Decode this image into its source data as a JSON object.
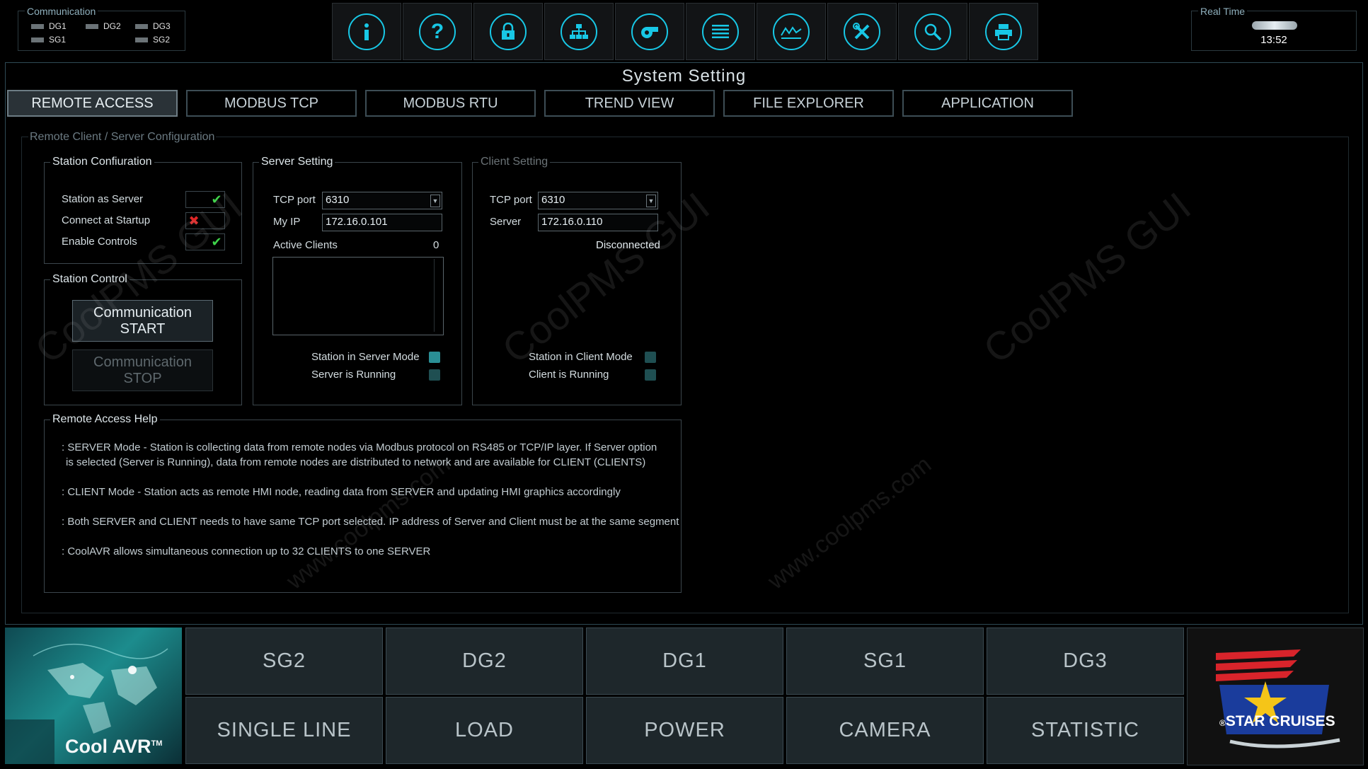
{
  "communication": {
    "title": "Communication",
    "channels": [
      "DG1",
      "DG2",
      "DG3",
      "SG1",
      "SG2"
    ]
  },
  "toolbar": {
    "icons": [
      "info-icon",
      "help-icon",
      "lock-icon",
      "network-icon",
      "whistle-icon",
      "list-icon",
      "trend-icon",
      "tools-icon",
      "search-icon",
      "printer-icon"
    ]
  },
  "real_time": {
    "title": "Real Time",
    "time": "13:52"
  },
  "page_title": "System Setting",
  "tabs": [
    "REMOTE ACCESS",
    "MODBUS TCP",
    "MODBUS RTU",
    "TREND VIEW",
    "FILE EXPLORER",
    "APPLICATION"
  ],
  "section_title": "Remote Client / Server Configuration",
  "station_configuration": {
    "title": "Station Confiuration",
    "items": [
      {
        "label": "Station as Server",
        "state": "checked"
      },
      {
        "label": "Connect at Startup",
        "state": "crossed"
      },
      {
        "label": "Enable Controls",
        "state": "checked"
      }
    ]
  },
  "station_control": {
    "title": "Station Control",
    "start_line1": "Communication",
    "start_line2": "START",
    "stop_line1": "Communication",
    "stop_line2": "STOP"
  },
  "server_setting": {
    "title": "Server Setting",
    "tcp_port_label": "TCP port",
    "tcp_port": "6310",
    "my_ip_label": "My IP",
    "my_ip": "172.16.0.101",
    "active_clients_label": "Active Clients",
    "active_clients": "0",
    "mode_label": "Station in Server Mode",
    "running_label": "Server is Running"
  },
  "client_setting": {
    "title": "Client Setting",
    "tcp_port_label": "TCP port",
    "tcp_port": "6310",
    "server_label": "Server",
    "server_ip": "172.16.0.110",
    "status": "Disconnected",
    "mode_label": "Station in Client Mode",
    "running_label": "Client is Running"
  },
  "help": {
    "title": "Remote Access Help",
    "line1": ": SERVER Mode - Station is collecting data from remote nodes via Modbus protocol on RS485 or TCP/IP layer. If Server option",
    "line2": "is selected (Server is Running), data from remote nodes are distributed to network and are available for CLIENT (CLIENTS)",
    "line3": ": CLIENT Mode - Station acts as remote HMI node, reading data from SERVER and updating HMI graphics accordingly",
    "line4": ": Both SERVER and CLIENT needs to have same TCP port selected. IP address of Server and Client  must be at the same segment",
    "line5": ": CoolAVR allows simultaneous connection up to 32 CLIENTS to one SERVER"
  },
  "nav_row1": [
    "SG2",
    "DG2",
    "DG1",
    "SG1",
    "DG3"
  ],
  "nav_row2": [
    "SINGLE LINE",
    "LOAD",
    "POWER",
    "CAMERA",
    "STATISTIC"
  ],
  "logo_left": {
    "text": "Cool AVR",
    "tm": "TM"
  },
  "logo_right": {
    "text": "STAR CRUISES",
    "reg": "®"
  },
  "watermark": {
    "line1": "CoolPMS GUI",
    "line2": "www.coolpms.com"
  },
  "colors": {
    "accent": "#18c8e6",
    "check": "#3fd44a",
    "cross": "#e02626",
    "led_teal": "#2a8f95",
    "led_dark": "#1f4f52"
  }
}
